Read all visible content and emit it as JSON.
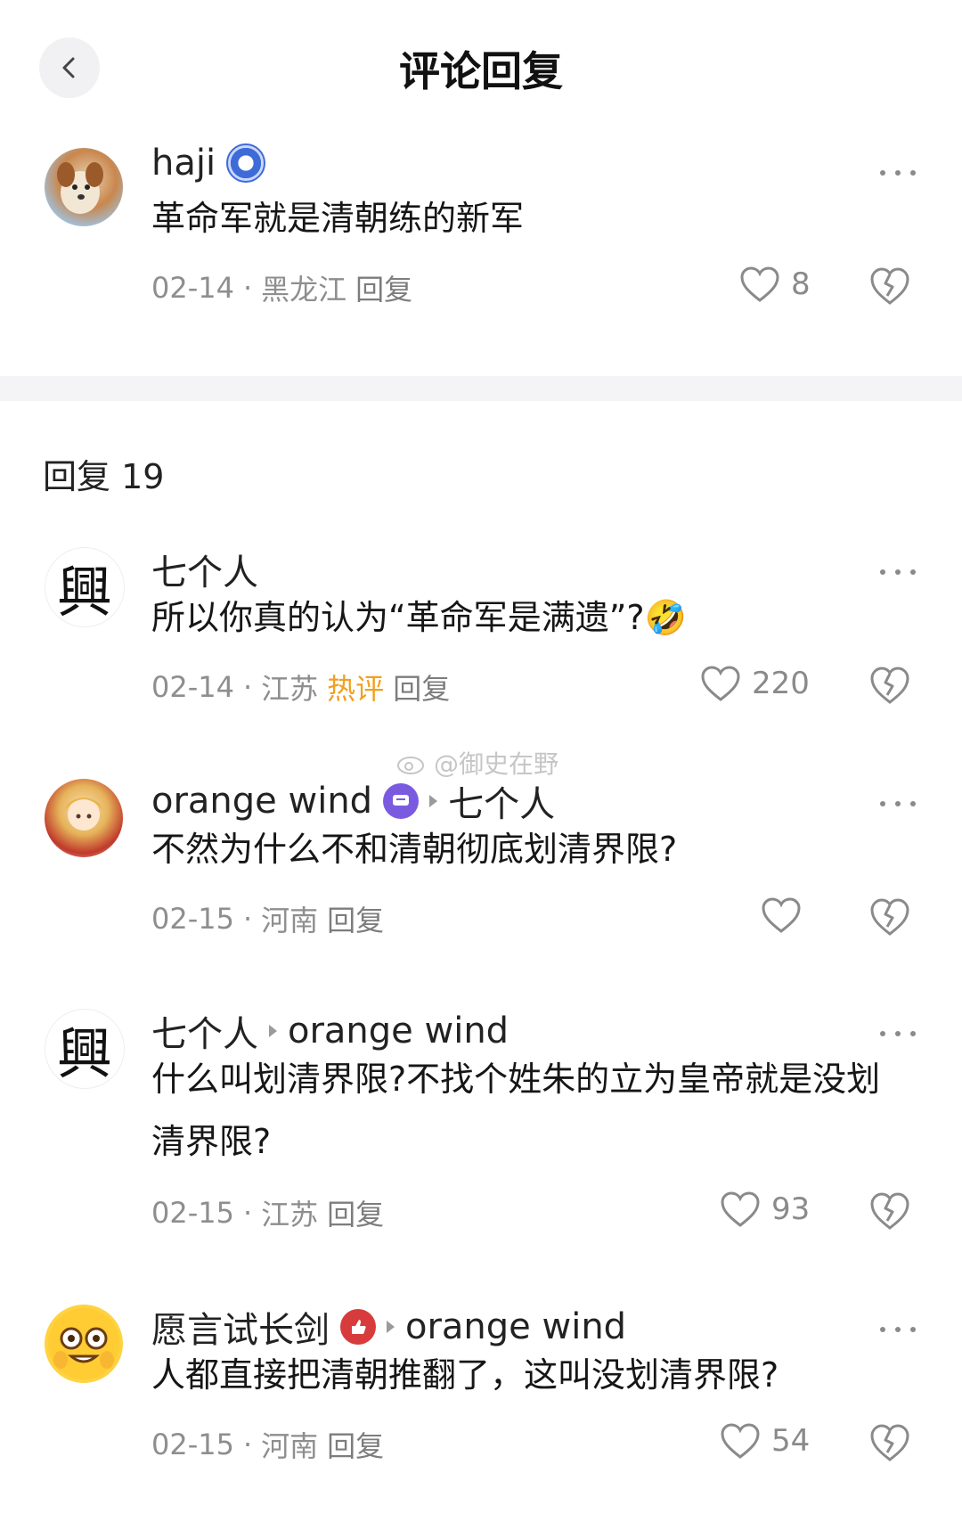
{
  "header": {
    "title": "评论回复",
    "back_icon": "back-arrow-icon"
  },
  "main_comment": {
    "user": "haji",
    "badge_icon": "member-badge-icon",
    "text": "革命军就是清朝练的新军",
    "date": "02-14",
    "location": "黑龙江",
    "reply_label": "回复",
    "likes": "8"
  },
  "replies_header": {
    "label": "回复 19"
  },
  "replies": [
    {
      "user": "七个人",
      "reply_to": "",
      "text": "所以你真的认为“革命军是满遗”?",
      "emoji": "🤣",
      "date": "02-14",
      "location": "江苏",
      "tag": "热评",
      "reply_label": "回复",
      "likes": "220"
    },
    {
      "user": "orange wind",
      "badge_icon": "chat-badge-icon",
      "reply_to": "七个人",
      "text": "不然为什么不和清朝彻底划清界限?",
      "date": "02-15",
      "location": "河南",
      "reply_label": "回复",
      "likes": ""
    },
    {
      "user": "七个人",
      "reply_to": "orange wind",
      "text": "什么叫划清界限?不找个姓朱的立为皇帝就是没划清界限?",
      "date": "02-15",
      "location": "江苏",
      "reply_label": "回复",
      "likes": "93"
    },
    {
      "user": "愿言试长剑",
      "badge_icon": "thumbs-up-badge-icon",
      "reply_to": "orange wind",
      "text": "人都直接把清朝推翻了，这叫没划清界限?",
      "date": "02-15",
      "location": "河南",
      "reply_label": "回复",
      "likes": "54"
    }
  ],
  "watermark": {
    "text": "@御史在野"
  },
  "colors": {
    "hot_tag": "#f0a020",
    "meta": "#8e8e8e",
    "divider": "#f4f4f6"
  }
}
